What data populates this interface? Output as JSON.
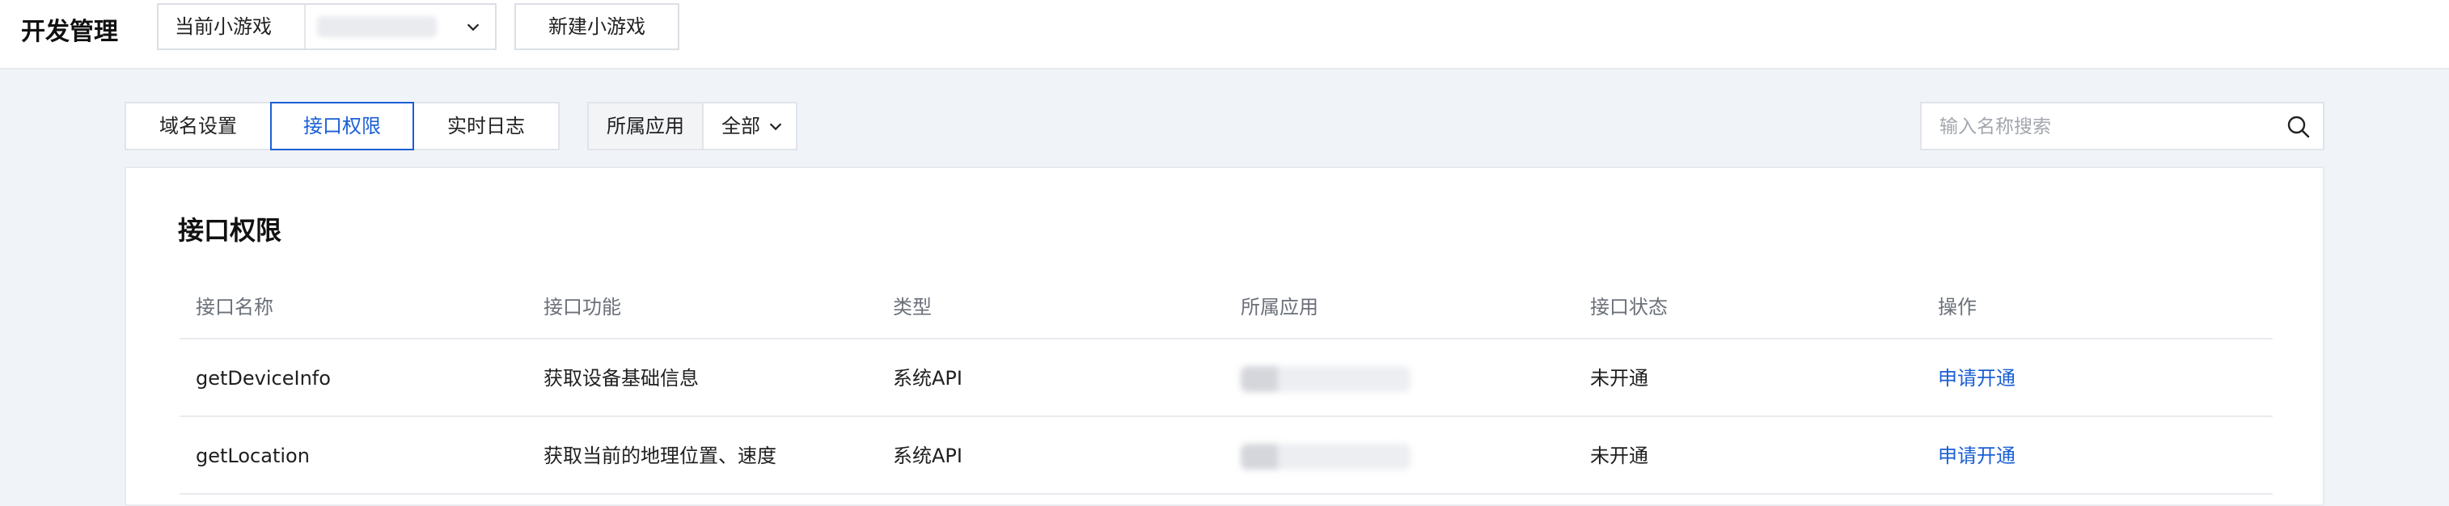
{
  "header": {
    "title": "开发管理",
    "game_select_label": "当前小游戏",
    "game_select_value": "",
    "new_game_button": "新建小游戏"
  },
  "tabs": [
    {
      "label": "域名设置",
      "active": false
    },
    {
      "label": "接口权限",
      "active": true
    },
    {
      "label": "实时日志",
      "active": false
    }
  ],
  "filter": {
    "label": "所属应用",
    "value": "全部"
  },
  "search": {
    "placeholder": "输入名称搜索",
    "value": ""
  },
  "panel": {
    "title": "接口权限",
    "columns": [
      "接口名称",
      "接口功能",
      "类型",
      "所属应用",
      "接口状态",
      "操作"
    ],
    "rows": [
      {
        "name": "getDeviceInfo",
        "func": "获取设备基础信息",
        "type": "系统API",
        "app": "",
        "status": "未开通",
        "action": "申请开通"
      },
      {
        "name": "getLocation",
        "func": "获取当前的地理位置、速度",
        "type": "系统API",
        "app": "",
        "status": "未开通",
        "action": "申请开通"
      }
    ]
  },
  "colors": {
    "accent": "#1a5fd6",
    "page_bg": "#f0f3f7"
  }
}
